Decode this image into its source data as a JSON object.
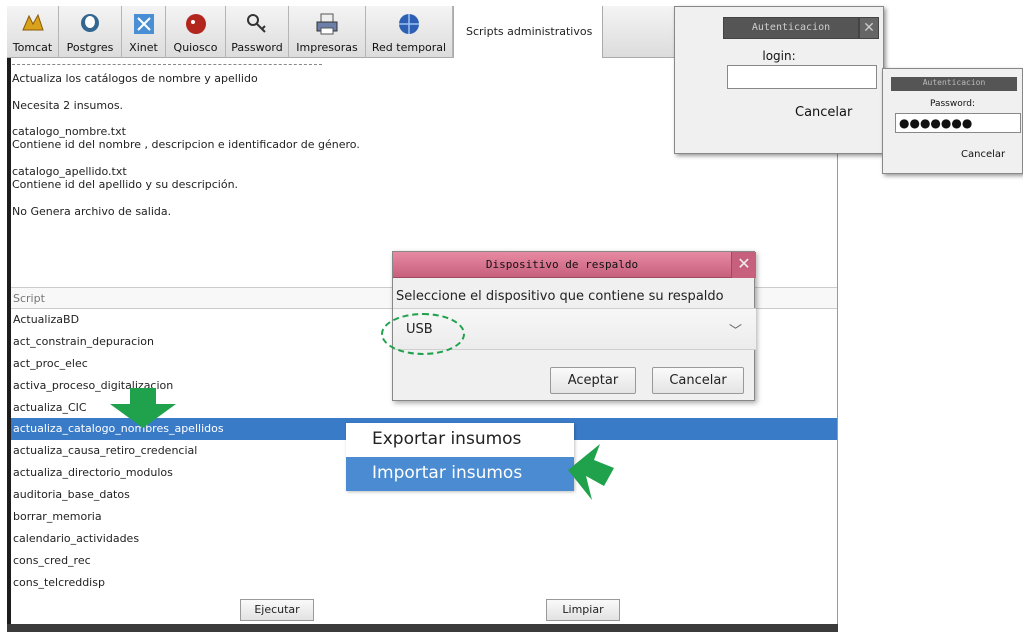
{
  "toolbar": {
    "tools": [
      {
        "label": "Tomcat",
        "icon": "tomcat-icon"
      },
      {
        "label": "Postgres",
        "icon": "postgres-icon"
      },
      {
        "label": "Xinet",
        "icon": "xinet-icon"
      },
      {
        "label": "Quiosco",
        "icon": "quiosco-icon"
      },
      {
        "label": "Password",
        "icon": "password-key-icon"
      },
      {
        "label": "Impresoras",
        "icon": "printer-icon"
      },
      {
        "label": "Red temporal",
        "icon": "network-globe-icon"
      }
    ],
    "active_tab": "Scripts administrativos"
  },
  "description": {
    "lines": [
      "Actualiza los catálogos de nombre y apellido",
      "Necesita 2 insumos.",
      "catalogo_nombre.txt",
      "Contiene id del nombre  , descripcion e identificador de género.",
      "catalogo_apellido.txt",
      "Contiene id del apellido y su descripción.",
      "No Genera archivo de salida."
    ]
  },
  "script_list": {
    "header": "Script",
    "items": [
      "ActualizaBD",
      "act_constrain_depuracion",
      "act_proc_elec",
      "activa_proceso_digitalizacion",
      "actualiza_CIC",
      "actualiza_catalogo_nombres_apellidos",
      "actualiza_causa_retiro_credencial",
      "actualiza_directorio_modulos",
      "auditoria_base_datos",
      "borrar_memoria",
      "calendario_actividades",
      "cons_cred_rec",
      "cons_telcreddisp"
    ],
    "selected": "actualiza_catalogo_nombres_apellidos"
  },
  "buttons": {
    "execute": "Ejecutar",
    "clear": "Limpiar"
  },
  "login_dialog": {
    "title": "Autenticacion",
    "label": "login:",
    "cancel": "Cancelar"
  },
  "password_dialog": {
    "title": "Autenticacion",
    "label": "Password:",
    "value": "●●●●●●●",
    "cancel": "Cancelar"
  },
  "backup_dialog": {
    "title": "Dispositivo de respaldo",
    "message": "Seleccione el dispositivo que contiene su respaldo",
    "device": "USB",
    "ok": "Aceptar",
    "cancel": "Cancelar"
  },
  "context_menu": {
    "export": "Exportar insumos",
    "import": "Importar insumos"
  },
  "colors": {
    "selection": "#3a7bc8",
    "menu_highlight": "#4a8bd2",
    "dialog_title": "#c6607c",
    "annotation_green": "#1fa24b"
  }
}
